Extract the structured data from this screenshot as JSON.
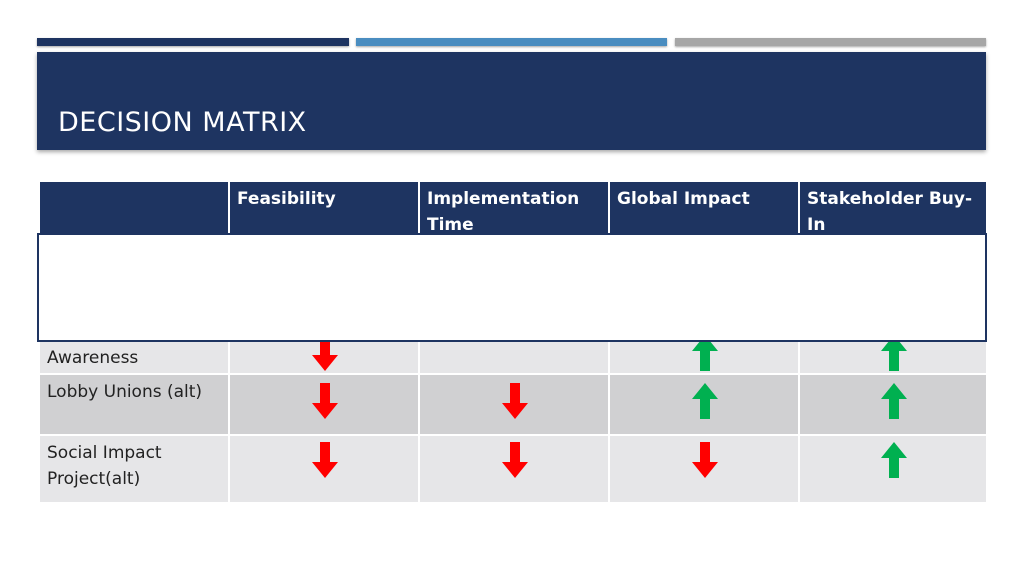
{
  "slide": {
    "title": "DECISION MATRIX",
    "colors": {
      "navy": "#1e3461",
      "accent_blue": "#4a8dc0",
      "accent_gray": "#a6a6a6",
      "arrow_down": "#ff0000",
      "arrow_up": "#00b050"
    }
  },
  "table": {
    "headers": [
      "",
      "Feasibility",
      "Implementation Time",
      "Global Impact",
      "Stakeholder Buy-In"
    ],
    "rows": [
      {
        "label": "Awareness",
        "marks": [
          "down",
          "",
          "up",
          "up"
        ]
      },
      {
        "label": "Lobby Unions (alt)",
        "marks": [
          "down",
          "down",
          "up",
          "up"
        ]
      },
      {
        "label": "Social Impact Project(alt)",
        "marks": [
          "down",
          "down",
          "down",
          "up"
        ]
      }
    ]
  }
}
